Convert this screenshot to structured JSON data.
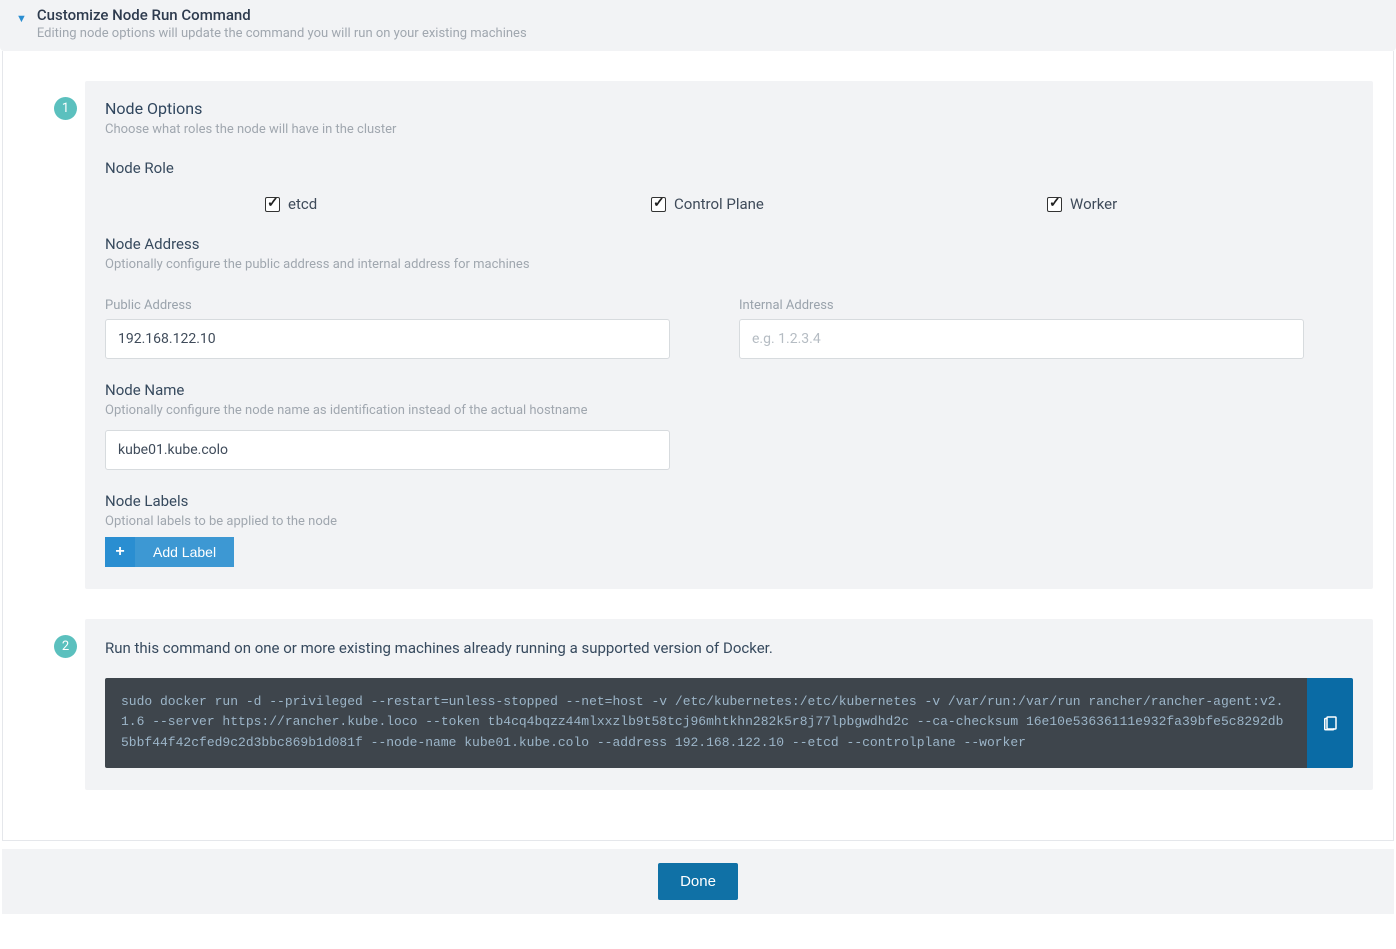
{
  "header": {
    "title": "Customize Node Run Command",
    "subtitle": "Editing node options will update the command you will run on your existing machines"
  },
  "step1": {
    "badge": "1",
    "title": "Node Options",
    "subtitle": "Choose what roles the node will have in the cluster",
    "node_role_label": "Node Role",
    "roles": {
      "etcd": "etcd",
      "control_plane": "Control Plane",
      "worker": "Worker"
    },
    "node_address_label": "Node Address",
    "node_address_sub": "Optionally configure the public address and internal address for machines",
    "public_address_label": "Public Address",
    "public_address_value": "192.168.122.10",
    "internal_address_label": "Internal Address",
    "internal_address_placeholder": "e.g. 1.2.3.4",
    "node_name_label": "Node Name",
    "node_name_sub": "Optionally configure the node name as identification instead of the actual hostname",
    "node_name_value": "kube01.kube.colo",
    "node_labels_label": "Node Labels",
    "node_labels_sub": "Optional labels to be applied to the node",
    "add_label_btn": "Add Label"
  },
  "step2": {
    "badge": "2",
    "intro": "Run this command on one or more existing machines already running a supported version of Docker.",
    "command": "sudo docker run -d --privileged --restart=unless-stopped --net=host -v /etc/kubernetes:/etc/kubernetes -v /var/run:/var/run rancher/rancher-agent:v2.1.6 --server https://rancher.kube.loco --token tb4cq4bqzz44mlxxzlb9t58tcj96mhtkhn282k5r8j77lpbgwdhd2c --ca-checksum 16e10e53636111e932fa39bfe5c8292db5bbf44f42cfed9c2d3bbc869b1d081f --node-name kube01.kube.colo --address 192.168.122.10 --etcd --controlplane --worker"
  },
  "footer": {
    "done": "Done"
  }
}
